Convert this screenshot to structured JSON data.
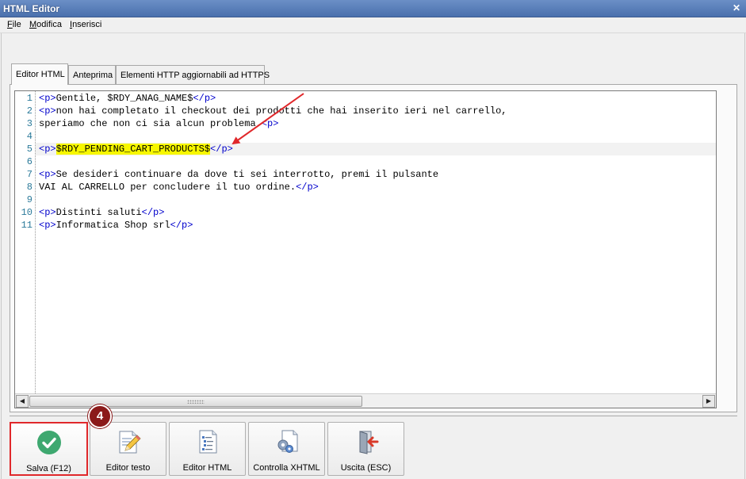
{
  "window": {
    "title": "HTML Editor",
    "close_symbol": "✕"
  },
  "menu": {
    "items": [
      "File",
      "Modifica",
      "Inserisci"
    ]
  },
  "tabs": [
    {
      "label": "Editor HTML",
      "active": true
    },
    {
      "label": "Anteprima",
      "active": false
    },
    {
      "label": "Elementi HTTP aggiornabili ad HTTPS",
      "active": false
    }
  ],
  "editor": {
    "current_line": 5,
    "lines": [
      {
        "n": "1",
        "parts": [
          [
            "tag",
            "<p>"
          ],
          [
            "text",
            "Gentile, $RDY_ANAG_NAME$"
          ],
          [
            "tag",
            "</p>"
          ]
        ]
      },
      {
        "n": "2",
        "parts": [
          [
            "tag",
            "<p>"
          ],
          [
            "text",
            "non hai completato il checkout dei prodotti che hai inserito ieri nel carrello,"
          ]
        ]
      },
      {
        "n": "3",
        "parts": [
          [
            "text",
            "speriamo che non ci sia alcun problema."
          ],
          [
            "tag",
            "<p>"
          ]
        ]
      },
      {
        "n": "4",
        "parts": []
      },
      {
        "n": "5",
        "parts": [
          [
            "tag",
            "<p>"
          ],
          [
            "hl",
            "$RDY_PENDING_CART_PRODUCTS$"
          ],
          [
            "tag",
            "</p>"
          ]
        ]
      },
      {
        "n": "6",
        "parts": []
      },
      {
        "n": "7",
        "parts": [
          [
            "tag",
            "<p>"
          ],
          [
            "text",
            "Se desideri continuare da dove ti sei interrotto, premi il pulsante"
          ]
        ]
      },
      {
        "n": "8",
        "parts": [
          [
            "text",
            "VAI AL CARRELLO per concludere il tuo ordine."
          ],
          [
            "tag",
            "</p>"
          ]
        ]
      },
      {
        "n": "9",
        "parts": []
      },
      {
        "n": "10",
        "parts": [
          [
            "tag",
            "<p>"
          ],
          [
            "text",
            "Distinti saluti"
          ],
          [
            "tag",
            "</p>"
          ]
        ]
      },
      {
        "n": "11",
        "parts": [
          [
            "tag",
            "<p>"
          ],
          [
            "text",
            "Informatica Shop srl"
          ],
          [
            "tag",
            "</p>"
          ]
        ]
      }
    ]
  },
  "scrollbar": {
    "left_arrow": "◀",
    "right_arrow": "▶"
  },
  "buttons": {
    "save": "Salva (F12)",
    "text_editor": "Editor testo",
    "html_editor": "Editor HTML",
    "check_xhtml": "Controlla XHTML",
    "exit": "Uscita (ESC)"
  },
  "annotation": {
    "step": "4"
  },
  "colors": {
    "highlight": "#f7f700",
    "tag": "#0000cc",
    "annotation": "#e0282b",
    "badge": "#8b1a1a",
    "save_icon": "#3ea870"
  }
}
